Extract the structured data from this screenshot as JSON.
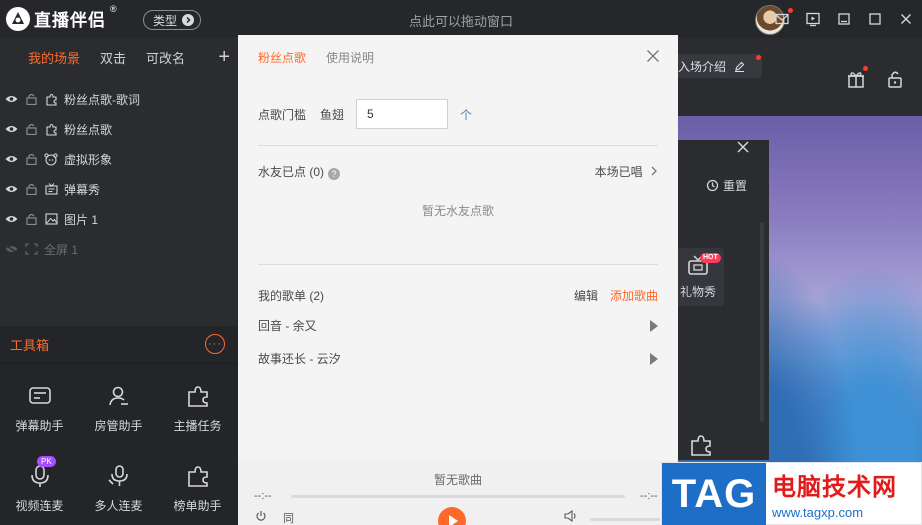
{
  "app": {
    "logo_text": "直播伴侣",
    "logo_sup": "®",
    "type_button": "类型",
    "drag_hint": "点此可以拖动窗口"
  },
  "top_icons": [
    "mail-icon",
    "video-icon",
    "minimize-icon",
    "maximize-icon",
    "close-icon"
  ],
  "scenes": {
    "tabs": [
      {
        "label": "我的场景",
        "active": true
      },
      {
        "label": "双击",
        "active": false
      },
      {
        "label": "可改名",
        "active": false
      }
    ],
    "add_label": "+"
  },
  "sources": [
    {
      "name": "粉丝点歌-歌词",
      "icon": "puzzle-icon",
      "dim": false
    },
    {
      "name": "粉丝点歌",
      "icon": "puzzle-icon",
      "dim": false
    },
    {
      "name": "虚拟形象",
      "icon": "avatar-icon",
      "dim": false
    },
    {
      "name": "弹幕秀",
      "icon": "danmaku-icon",
      "dim": false
    },
    {
      "name": "图片 1",
      "icon": "image-icon",
      "dim": false
    },
    {
      "name": "全屏 1",
      "icon": "fullscreen-icon",
      "dim": true
    }
  ],
  "toolbox": {
    "title": "工具箱",
    "more": "···",
    "tools": [
      {
        "label": "弹幕助手",
        "icon": "danmaku-assistant-icon"
      },
      {
        "label": "房管助手",
        "icon": "room-admin-icon"
      },
      {
        "label": "主播任务",
        "icon": "puzzle-icon"
      },
      {
        "label": "视频连麦",
        "icon": "mic-icon",
        "badge": "PK"
      },
      {
        "label": "多人连麦",
        "icon": "multi-mic-icon"
      },
      {
        "label": "榜单助手",
        "icon": "puzzle-icon"
      }
    ]
  },
  "dialog": {
    "tabs": [
      {
        "label": "粉丝点歌",
        "active": true
      },
      {
        "label": "使用说明",
        "active": false
      }
    ],
    "threshold_label": "点歌门槛",
    "threshold_currency": "鱼翅",
    "threshold_value": "5",
    "threshold_unit": "个",
    "fans_heading": "水友已点 (0)",
    "fans_help": "?",
    "sung_link": "本场已唱",
    "fans_empty": "暂无水友点歌",
    "playlist_heading": "我的歌单 (2)",
    "edit": "编辑",
    "add_song": "添加歌曲",
    "songs": [
      "回音 - 余又",
      "故事还长 - 云汐"
    ]
  },
  "player": {
    "status": "暂无歌曲",
    "time_left": "--:--",
    "time_right": "--:--",
    "loop_label": "同"
  },
  "preview": {
    "intro": "入场介绍",
    "reset": "重置",
    "gift_show": "礼物秀",
    "hot": "HOT"
  },
  "watermark": {
    "tag": "TAG",
    "title": "电脑技术网",
    "url": "www.tagxp.com"
  },
  "colors": {
    "accent": "#ff6a2a",
    "dark_bg": "#2b2c30",
    "dialog_bg": "#f4f4f5",
    "watermark_blue": "#1e6ec8",
    "watermark_red": "#e11b1b"
  }
}
